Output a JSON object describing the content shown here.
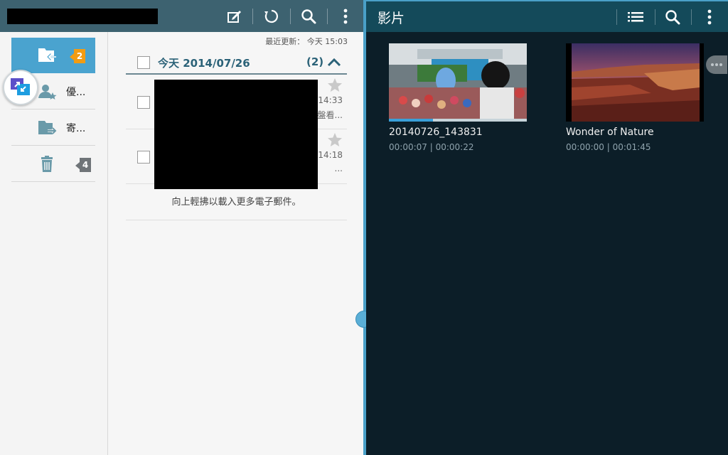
{
  "email": {
    "toolbar": {
      "compose_icon": "compose-icon",
      "refresh_icon": "refresh-icon",
      "search_icon": "search-icon",
      "more_icon": "more-vert-icon"
    },
    "folders": [
      {
        "label": "",
        "badge": "2",
        "icon": "inbox-folder-icon"
      },
      {
        "label": "優...",
        "badge": "",
        "icon": "priority-sender-icon"
      },
      {
        "label": "寄...",
        "badge": "",
        "icon": "sent-folder-icon"
      },
      {
        "label": "",
        "badge": "4",
        "icon": "trash-icon"
      }
    ],
    "last_update": "最近更新： 今天 15:03",
    "group": {
      "date": "今天  2014/07/26",
      "count": "(2)"
    },
    "messages": [
      {
        "time": "14:33",
        "snippet": "盤看..."
      },
      {
        "time": "14:18",
        "snippet": "..."
      }
    ],
    "load_more": "向上輕拂以載入更多電子郵件。"
  },
  "video": {
    "title": "影片",
    "toolbar": {
      "list_icon": "list-view-icon",
      "search_icon": "search-icon",
      "more_icon": "more-vert-icon"
    },
    "items": [
      {
        "name": "20140726_143831",
        "duration": "00:00:07 | 00:00:22",
        "progress": 0.32
      },
      {
        "name": "Wonder of Nature",
        "duration": "00:00:00 | 00:01:45",
        "progress": 0
      }
    ]
  },
  "colors": {
    "email_topbar": "#3d6270",
    "active_folder": "#4aa3cf",
    "badge_orange": "#f39c12",
    "video_bg": "#0c1e28",
    "video_topbar": "#144a5a",
    "accent_blue": "#4aa0c8"
  }
}
